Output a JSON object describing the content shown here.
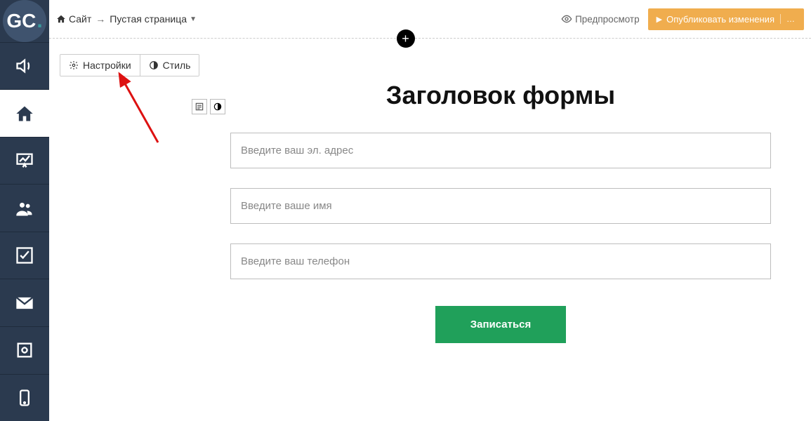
{
  "logo_letters": "GC",
  "breadcrumb": {
    "site": "Сайт",
    "page": "Пустая страница"
  },
  "topbar": {
    "preview": "Предпросмотр",
    "publish": "Опубликовать изменения"
  },
  "toolbar": {
    "settings": "Настройки",
    "style": "Стиль"
  },
  "form": {
    "title": "Заголовок формы",
    "email_placeholder": "Введите ваш эл. адрес",
    "name_placeholder": "Введите ваше имя",
    "phone_placeholder": "Введите ваш телефон",
    "submit": "Записаться"
  },
  "sidebar_icons": [
    "sound-icon",
    "home-icon",
    "chart-presentation-icon",
    "users-icon",
    "checkbox-icon",
    "mail-icon",
    "safe-icon",
    "phone-icon"
  ]
}
